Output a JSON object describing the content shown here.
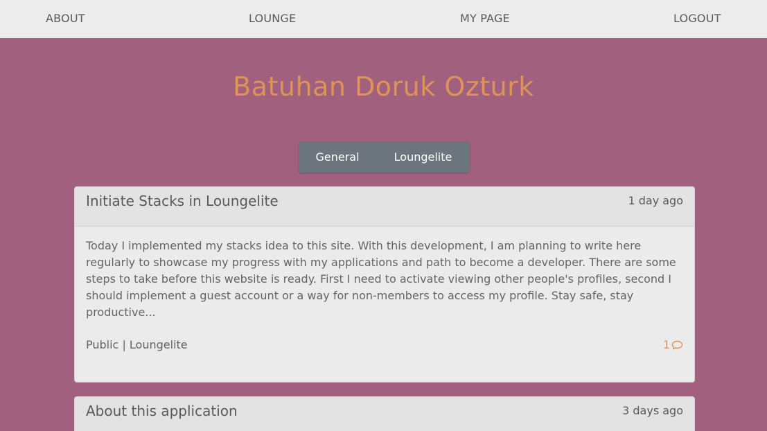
{
  "nav": {
    "about": "ABOUT",
    "lounge": "LOUNGE",
    "my_page": "MY PAGE",
    "logout": "LOGOUT"
  },
  "profile": {
    "name": "Batuhan Doruk Ozturk"
  },
  "tabs": [
    {
      "label": "General"
    },
    {
      "label": "Loungelite"
    }
  ],
  "posts": [
    {
      "title": "Initiate Stacks in Loungelite",
      "time": "1 day ago",
      "body": "Today I implemented my stacks idea to this site. With this development, I am planning to write here regularly to showcase my progress with my applications and path to become a developer. There are some steps to take before this website is ready. First I need to activate viewing other people's profiles, second I should implement a guest account or a way for non-members to access my profile. Stay safe, stay productive...",
      "meta": "Public | Loungelite",
      "comments": "1",
      "comment_icon": "speech-bubble-icon"
    },
    {
      "title": "About this application",
      "time": "3 days ago"
    }
  ],
  "colors": {
    "background": "#a0607e",
    "accent": "#de9358",
    "tab_bg": "#6c757d",
    "nav_bg": "#ececec"
  }
}
